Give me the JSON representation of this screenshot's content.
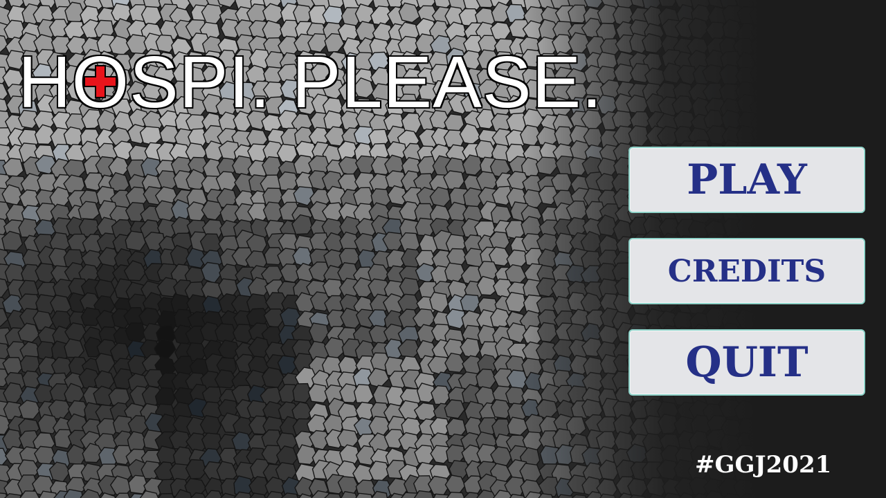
{
  "title": {
    "part1": "H",
    "o_letter": "O",
    "part2": "SPI. PLEASE.",
    "cross_color": "#e8141b"
  },
  "menu": {
    "play_label": "PLAY",
    "credits_label": "CREDITS",
    "quit_label": "QUIT",
    "button_bg": "#e4e5e8",
    "button_border": "#8fd3c9",
    "text_color": "#253087"
  },
  "footer": {
    "hashtag": "#GGJ2021"
  },
  "background": {
    "style": "stained-glass mosaic, grayscale",
    "icon": "mosaic-background"
  }
}
